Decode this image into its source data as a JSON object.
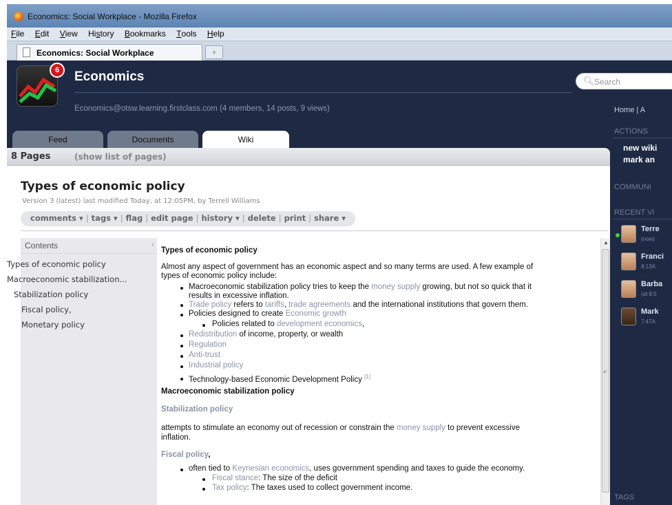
{
  "window": {
    "title": "Economics: Social Workplace - Mozilla Firefox"
  },
  "menu": {
    "items": [
      {
        "label": "File",
        "u": "F",
        "rest": "ile"
      },
      {
        "label": "Edit",
        "u": "E",
        "rest": "dit"
      },
      {
        "label": "View",
        "u": "V",
        "rest": "iew"
      },
      {
        "label": "History",
        "pre": "Hi",
        "u": "s",
        "rest": "tory"
      },
      {
        "label": "Bookmarks",
        "u": "B",
        "rest": "ookmarks"
      },
      {
        "label": "Tools",
        "u": "T",
        "rest": "ools"
      },
      {
        "label": "Help",
        "u": "H",
        "rest": "elp"
      }
    ]
  },
  "browser_tab": {
    "label": "Economics: Social Workplace",
    "new_tab": "+"
  },
  "group": {
    "badge": "6",
    "name": "Economics",
    "meta": "Economics@otsw.learning.firstclass.com (4 members, 14 posts, 9 views)"
  },
  "search": {
    "placeholder": "Search"
  },
  "tabs": {
    "feed": "Feed",
    "documents": "Documents",
    "wiki": "Wiki"
  },
  "pages_header": {
    "count": "8 Pages",
    "show": "(show list of pages)"
  },
  "page": {
    "title": "Types of economic policy",
    "version": "Version 3 (latest) last modified Today, at 12:05PM, by Terrell Williams"
  },
  "toolbar": {
    "comments": "comments ▾",
    "tags": "tags ▾",
    "flag": "flag",
    "edit": "edit page",
    "history": "history ▾",
    "delete": "delete",
    "print": "print",
    "share": "share ▾",
    "sep": "|"
  },
  "toc": {
    "heading": "Contents",
    "collapse": "‹",
    "items": [
      "Types of economic policy",
      "Macroeconomic stabilization...",
      "Stabilization policy",
      "Fiscal policy,",
      "Monetary policy"
    ]
  },
  "content": {
    "h1": "Types of economic policy",
    "intro1": "Almost any aspect of government has an economic aspect and so many terms are used. A few example of",
    "intro2": "types of economic policy include:",
    "b1a_pre": "Macroeconomic stabilization policy tries to keep the ",
    "b1a_link": "money supply",
    "b1a_post": " growing, but not so quick that it",
    "b1b": "results in excessive inflation.",
    "b2_link1": "Trade policy",
    "b2_t1": " refers to ",
    "b2_link2": "tariffs",
    "b2_t2": ", ",
    "b2_link3": "trade agreements",
    "b2_t3": " and the international institutions that govern them.",
    "b3_pre": "Policies designed to create ",
    "b3_link": "Economic growth",
    "b3s_pre": "Policies related to ",
    "b3s_link": "development economics",
    "b3s_post": ",",
    "b4_link": "Redistribution",
    "b4_post": " of income, property, or wealth",
    "b5": "Regulation",
    "b6": "Anti-trust",
    "b7": "Industrial policy",
    "b8": "Technology-based Economic Development Policy",
    "b8_ref": "[1]",
    "h2": "Macroeconomic stabilization policy",
    "h3": "Stabilization policy",
    "p1a_pre": "attempts to stimulate an economy out of recession or constrain the ",
    "p1a_link": "money supply",
    "p1a_post": " to prevent excessive",
    "p1b": "inflation.",
    "h4_link": "Fiscal policy",
    "h4_post": ",",
    "f1_pre": "often tied to ",
    "f1_link": "Keynesian economics",
    "f1_post": ", uses government spending and taxes to guide the economy.",
    "f2_link": "Fiscal stance",
    "f2_post": ": The size of the deficit",
    "f3_link": "Tax policy",
    "f3_post": ": The taxes used to collect government income."
  },
  "sidebar": {
    "nav": "Home | A",
    "actions_head": "ACTIONS",
    "action1": "new wiki",
    "action2": "mark an",
    "community_head": "COMMUNI",
    "recent_head": "RECENT VI",
    "visitors": [
      {
        "name": "Terre",
        "time": "(now)"
      },
      {
        "name": "Franci",
        "time": "8:13A"
      },
      {
        "name": "Barba",
        "time": "(at 8:5"
      },
      {
        "name": "Mark",
        "time": "7:47A"
      }
    ],
    "tags_head": "TAGS"
  },
  "colors": {
    "link": "#8a93a8",
    "app_bg": "#1e2a44",
    "badge": "#d7141b",
    "online": "#3ad23a"
  }
}
